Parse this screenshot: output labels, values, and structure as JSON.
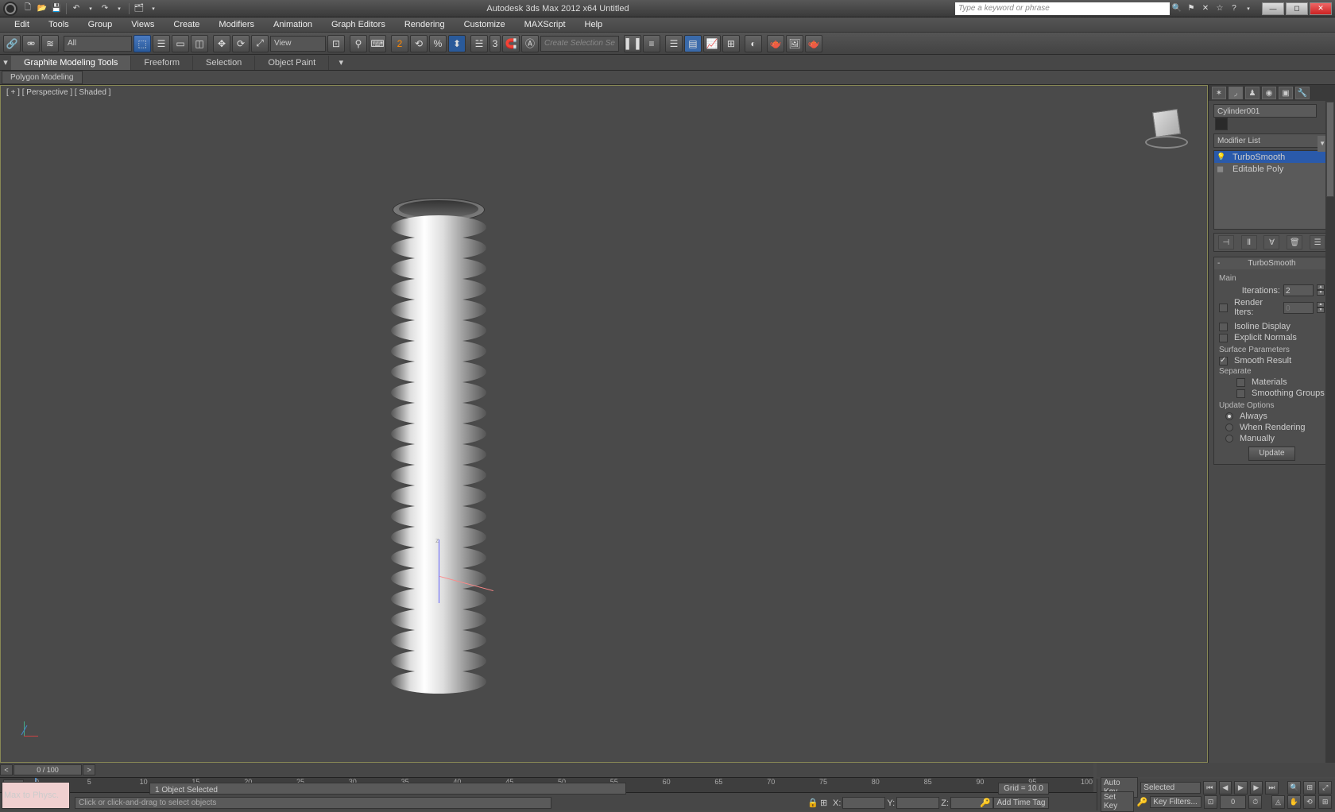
{
  "title": "Autodesk 3ds Max 2012 x64     Untitled",
  "search_placeholder": "Type a keyword or phrase",
  "menus": [
    "Edit",
    "Tools",
    "Group",
    "Views",
    "Create",
    "Modifiers",
    "Animation",
    "Graph Editors",
    "Rendering",
    "Customize",
    "MAXScript",
    "Help"
  ],
  "sel_filter": "All",
  "view_combo": "View",
  "create_sel": "Create Selection Se",
  "angle_snap": "3",
  "ribbon": {
    "tabs": [
      "Graphite Modeling Tools",
      "Freeform",
      "Selection",
      "Object Paint"
    ],
    "sub": "Polygon Modeling"
  },
  "viewport": {
    "label": "[ + ] [ Perspective ] [ Shaded ]"
  },
  "side": {
    "object_name": "Cylinder001",
    "modifier_list": "Modifier List",
    "stack": [
      {
        "name": "TurboSmooth",
        "sel": true,
        "bulb": true
      },
      {
        "name": "Editable Poly",
        "sel": false,
        "bulb": false
      }
    ],
    "rollout_title": "TurboSmooth",
    "main_label": "Main",
    "iterations_label": "Iterations:",
    "iterations": "2",
    "render_iters_label": "Render Iters:",
    "render_iters": "0",
    "isoline": "Isoline Display",
    "explicit": "Explicit Normals",
    "surf_params": "Surface Parameters",
    "smooth_result": "Smooth Result",
    "separate": "Separate",
    "materials": "Materials",
    "smoothing_groups": "Smoothing Groups",
    "update_options": "Update Options",
    "always": "Always",
    "when_rendering": "When Rendering",
    "manually": "Manually",
    "update_btn": "Update"
  },
  "timeslider": {
    "frame": "0 / 100"
  },
  "timeline_ticks": [
    0,
    5,
    10,
    15,
    20,
    25,
    30,
    35,
    40,
    45,
    50,
    55,
    60,
    65,
    70,
    75,
    80,
    85,
    90,
    95,
    100
  ],
  "status": {
    "mscript": "Max to Physc.",
    "selected": "1 Object Selected",
    "prompt": "Click or click-and-drag to select objects",
    "x": "",
    "y": "",
    "z": "",
    "grid": "Grid = 10.0",
    "timetag": "Add Time Tag"
  },
  "anim": {
    "autokey": "Auto Key",
    "setkey": "Set Key",
    "selected": "Selected",
    "keyfilters": "Key Filters..."
  }
}
